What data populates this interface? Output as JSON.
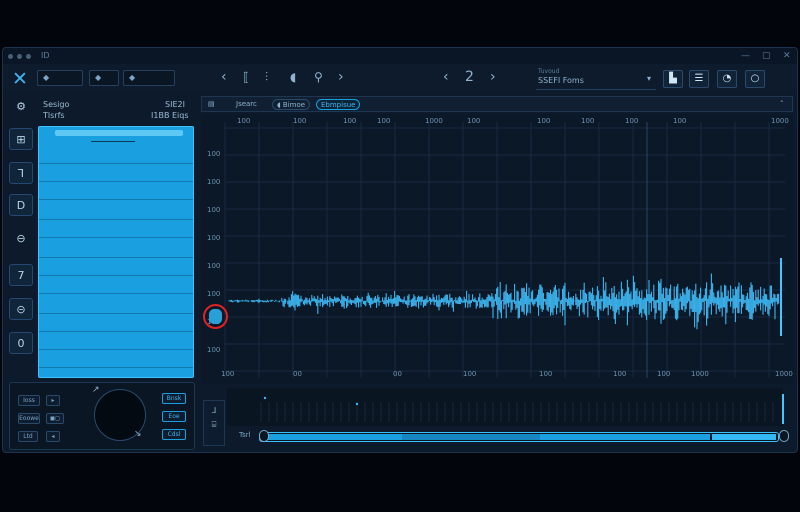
{
  "window": {
    "title": "ID"
  },
  "toolbar": {
    "select_1": "",
    "select_2": "",
    "select_3": "",
    "nav_prev": "‹",
    "nav_next": "›",
    "page": "2",
    "project_caption": "Tuvoud",
    "project_name": "SSEFI Foms"
  },
  "sidebar": {
    "header_left_1": "Sesigo",
    "header_left_2": "Tlsrfs",
    "header_right_1": "SIE2I",
    "header_right_2": "I1BB Eiqs",
    "rail_icons": [
      "gear-icon",
      "tag-icon",
      "bracket-icon",
      "d-icon",
      "eye-icon",
      "seven-icon",
      "minus-circle-icon",
      "zero-icon"
    ]
  },
  "transport": {
    "buttons_left": [
      "Ioss",
      "Eoowe",
      "Ltd"
    ],
    "buttons_right": [
      "Bnsk",
      "Eoe",
      "Cdsl"
    ]
  },
  "main_toolbar": {
    "tab_1": "Jsearc",
    "tab_2": "Bimoe",
    "tab_3": "Ebmpisue",
    "collapse": "˄"
  },
  "plot": {
    "top_ticks": [
      "100",
      "100",
      "100",
      "100",
      "1000",
      "100",
      "100",
      "100",
      "100",
      "100",
      "1000"
    ],
    "left_ticks": [
      "100",
      "100",
      "100",
      "100",
      "100",
      "100",
      "100",
      "100"
    ],
    "bottom_ticks": [
      "100",
      "00",
      "00",
      "100",
      "100",
      "100",
      "100",
      "1000",
      "1000"
    ]
  },
  "bottom": {
    "track_label": "Tsrl",
    "ctrl_1": "⅃",
    "ctrl_2": "⌸"
  },
  "colors": {
    "accent": "#1aa0e0",
    "waveform": "#3cb6f0",
    "background": "#0c1a2b",
    "marker": "#e02222"
  }
}
